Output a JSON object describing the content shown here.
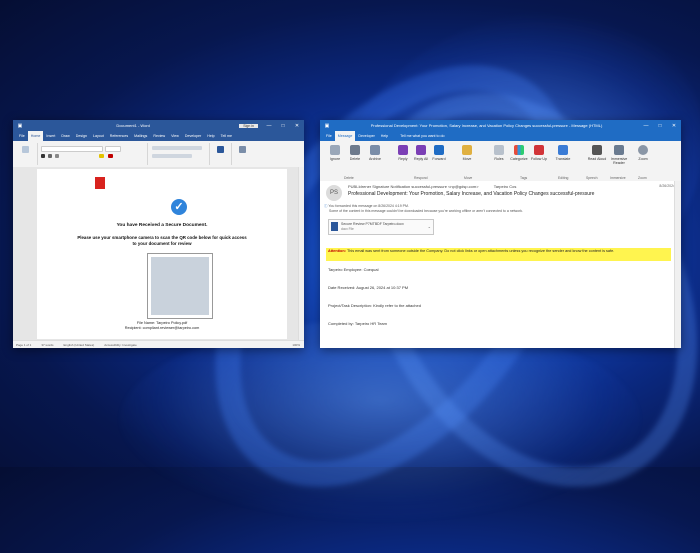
{
  "word": {
    "title": "Document1 - Word",
    "signin": "Sign in",
    "tabs": [
      "File",
      "Home",
      "Insert",
      "Draw",
      "Design",
      "Layout",
      "References",
      "Mailings",
      "Review",
      "View",
      "Developer",
      "Help"
    ],
    "tell_me": "Tell me",
    "document": {
      "heading": "You have Received a Secure Document.",
      "instruction": "Please use your smartphone camera to scan the QR code below for quick access to your document for review",
      "file_name": "File Name: Tarpeiro Policy.pdf",
      "recipient": "Recipient: compliant.reviewer@tarpeiro.com"
    },
    "status": {
      "page": "Page 1 of 1",
      "words": "37 words",
      "language": "English (United States)",
      "accessibility": "Accessibility: Investigate",
      "zoom": "100%"
    }
  },
  "outlook": {
    "title": "Professional Development: Your Promotion, Salary Increase, and Vacation Policy Changes successful-pressure - Message (HTML)",
    "tabs": [
      "File",
      "Message",
      "Developer",
      "Help"
    ],
    "tell_me": "Tell me what you want to do",
    "ribbon": {
      "buttons": [
        "Ignore",
        "Delete",
        "Archive",
        "Reply",
        "Reply All",
        "Forward",
        "Move",
        "Rules",
        "Categorize",
        "Follow Up",
        "Translate",
        "Read Aloud",
        "Immersive Reader",
        "Zoom"
      ],
      "groups": [
        "Delete",
        "Respond",
        "Move",
        "Tags",
        "Editing",
        "Speech",
        "Immersive",
        "Zoom"
      ]
    },
    "message": {
      "avatar": "PS",
      "from": "PUBLIdrener Signature Notification successful-pressure <np@gdsp.com>",
      "to": "Tarpeiro Cos",
      "date": "8/26/2024",
      "subject": "Professional Development: Your Promotion, Salary Increase, and Vacation Policy Changes successful-pressure",
      "info_forwarded": "You forwarded this message on 8/26/2024 4:19 PM.",
      "info_offline": "Some of the content in this message couldn't be downloaded because you're working offline or aren't connected to a network.",
      "attachment_name": "Secure Review P7MTBDF Tarpeiro.docx",
      "attachment_size": "docx File",
      "warning_label": "Attention:",
      "warning_text": "This email was sent from someone outside the Company. Do not click links or open attachments unless you recognize the sender and know the content is safe.",
      "lines": [
        "Tarpeiro Employee: Coequal",
        "Date Received: August 26, 2024 at 10:37 PM",
        "Project/Task Description: Kindly refer to the attached",
        "Completed by: Tarpeiro HR Team"
      ]
    }
  },
  "colors": {
    "word_blue": "#2b579a",
    "outlook_blue": "#1f6cc4",
    "warning_yellow": "#fff44f",
    "check_blue": "#2f84db",
    "adobe_red": "#d8231e"
  }
}
